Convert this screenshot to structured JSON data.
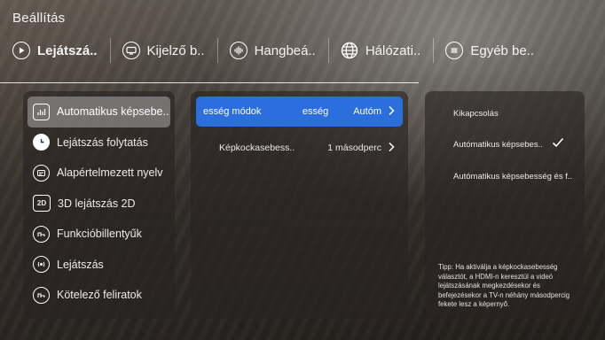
{
  "title": "Beállítás",
  "tabs": [
    {
      "label": "Lejátszá..",
      "icon": "play-icon",
      "active": true
    },
    {
      "label": "Kijelző b..",
      "icon": "display-icon",
      "active": false
    },
    {
      "label": "Hangbeá..",
      "icon": "sound-icon",
      "active": false
    },
    {
      "label": "Hálózati..",
      "icon": "globe-icon",
      "active": false
    },
    {
      "label": "Egyéb be..",
      "icon": "menu-icon",
      "active": false
    }
  ],
  "left_menu": [
    {
      "label": "Automatikus képsebe..",
      "icon": "bar-chart-icon",
      "selected": true
    },
    {
      "label": "Lejátszás folytatás",
      "icon": "clock-icon",
      "selected": false
    },
    {
      "label": "Alapértelmezett nyelv",
      "icon": "language-icon",
      "selected": false
    },
    {
      "label": "3D lejátszás 2D",
      "icon": "2d-icon",
      "icon_text": "2D",
      "selected": false
    },
    {
      "label": "Funkcióbillentyűk",
      "icon": "key-icon",
      "selected": false
    },
    {
      "label": "Lejátszás",
      "icon": "audio-wave-icon",
      "selected": false
    },
    {
      "label": "Kötelező feliratok",
      "icon": "subtitle-icon",
      "selected": false
    }
  ],
  "middle_menu": [
    {
      "label": "esség módok",
      "label_part2": "esség",
      "value": "Autóm",
      "selected": true
    },
    {
      "label": "Képkockasebess..",
      "value": "1 másodperc",
      "selected": false
    }
  ],
  "right_panel": {
    "options": [
      {
        "label": "Kikapcsolás",
        "checked": false
      },
      {
        "label": "Autómatikus képsebes..",
        "checked": true
      },
      {
        "label": "Autómatikus képsebesség és f..",
        "checked": false
      }
    ],
    "tip": "Tipp: Ha aktiválja a képkockasebesség választót, a HDMI-n keresztül a videó lejátszásának megkezdésekor és befejezésekor a TV-n néhány másodpercig fekete lesz a képernyő."
  },
  "colors": {
    "accent": "#2b6fdc",
    "selected_left": "#aaaaaa"
  }
}
